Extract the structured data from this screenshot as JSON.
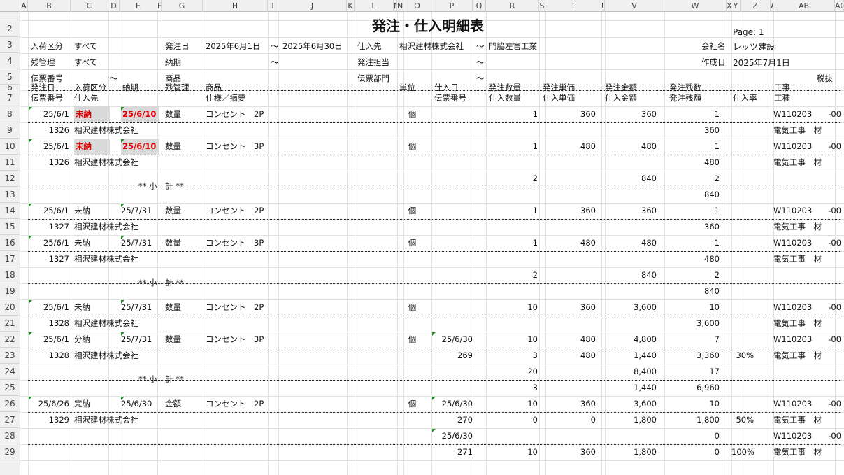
{
  "sheet": {
    "title": "発注・仕入明細表",
    "page": "Page: 1",
    "column_letters": [
      "A",
      "B",
      "C",
      "D",
      "E",
      "F",
      "G",
      "H",
      "I",
      "J",
      "K",
      "L",
      "M",
      "N",
      "O",
      "P",
      "Q",
      "R",
      "S",
      "T",
      "U",
      "V",
      "W",
      "X",
      "Y",
      "Z",
      "AA",
      "AB",
      "AC",
      "A"
    ],
    "row_numbers": [
      "1",
      "2",
      "3",
      "4",
      "5",
      "6",
      "7",
      "8",
      "9",
      "10",
      "11",
      "12",
      "13",
      "14",
      "15",
      "16",
      "17",
      "18",
      "19",
      "20",
      "21",
      "22",
      "23",
      "24",
      "25",
      "26",
      "27",
      "28",
      "29"
    ]
  },
  "filters": {
    "arrival_class_label": "入荷区分",
    "arrival_class_value": "すべて",
    "balance_mgmt_label": "残管理",
    "balance_mgmt_value": "すべて",
    "slip_no_label": "伝票番号",
    "slip_no_tilde": "～",
    "order_date_label": "発注日",
    "order_date_from": "2025年6月1日",
    "order_date_tilde": "～",
    "order_date_to": "2025年6月30日",
    "delivery_label": "納期",
    "delivery_tilde": "～",
    "product_label": "商品",
    "supplier_label": "仕入先",
    "supplier_from": "相沢建材株式会社",
    "supplier_tilde": "～",
    "supplier_to": "門脇左官工業",
    "staff_label": "発注担当",
    "staff_tilde": "～",
    "dept_label": "伝票部門",
    "dept_tilde": "～",
    "company_label": "会社名",
    "company_value": "レッツ建設",
    "created_label": "作成日",
    "created_value": "2025年7月1日",
    "tax_note": "税抜"
  },
  "headers": {
    "row6": [
      "発注日",
      "入荷区分",
      "納期",
      "残管理",
      "商品",
      "単位",
      "仕入日",
      "発注数量",
      "発注単価",
      "発注金額",
      "発注残数",
      "工事"
    ],
    "row7": [
      "伝票番号",
      "仕入先",
      "仕様／摘要",
      "伝票番号",
      "仕入数量",
      "仕入単価",
      "仕入金額",
      "発注残額",
      "仕入率",
      "工種"
    ]
  },
  "subtotal_label": "** 小　計 **",
  "rows": {
    "r8": {
      "date": "25/6/1",
      "cls": "未納",
      "due": "25/6/10",
      "mgmt": "数量",
      "item": "コンセント　2P",
      "unit": "個",
      "qty": "1",
      "price": "360",
      "amt": "360",
      "bal": "1",
      "koji": "W110203　　-00"
    },
    "r9": {
      "slip": "1326",
      "supplier": "相沢建材株式会社",
      "bal_amt": "360",
      "kind": "電気工事　材"
    },
    "r10": {
      "date": "25/6/1",
      "cls": "未納",
      "due": "25/6/10",
      "mgmt": "数量",
      "item": "コンセント　3P",
      "unit": "個",
      "qty": "1",
      "price": "480",
      "amt": "480",
      "bal": "1",
      "koji": "W110203　　-00"
    },
    "r11": {
      "slip": "1326",
      "supplier": "相沢建材株式会社",
      "bal_amt": "480",
      "kind": "電気工事　材"
    },
    "r12": {
      "qty": "2",
      "amt": "840",
      "bal": "2"
    },
    "r13": {
      "bal_amt": "840"
    },
    "r14": {
      "date": "25/6/1",
      "cls": "未納",
      "due": "25/7/31",
      "mgmt": "数量",
      "item": "コンセント　2P",
      "unit": "個",
      "qty": "1",
      "price": "360",
      "amt": "360",
      "bal": "1",
      "koji": "W110203　　-00"
    },
    "r15": {
      "slip": "1327",
      "supplier": "相沢建材株式会社",
      "bal_amt": "360",
      "kind": "電気工事　材"
    },
    "r16": {
      "date": "25/6/1",
      "cls": "未納",
      "due": "25/7/31",
      "mgmt": "数量",
      "item": "コンセント　3P",
      "unit": "個",
      "qty": "1",
      "price": "480",
      "amt": "480",
      "bal": "1",
      "koji": "W110203　　-00"
    },
    "r17": {
      "slip": "1327",
      "supplier": "相沢建材株式会社",
      "bal_amt": "480",
      "kind": "電気工事　材"
    },
    "r18": {
      "qty": "2",
      "amt": "840",
      "bal": "2"
    },
    "r19": {
      "bal_amt": "840"
    },
    "r20": {
      "date": "25/6/1",
      "cls": "未納",
      "due": "25/7/31",
      "mgmt": "数量",
      "item": "コンセント　2P",
      "unit": "個",
      "qty": "10",
      "price": "360",
      "amt": "3,600",
      "bal": "10",
      "koji": "W110203　　-00"
    },
    "r21": {
      "slip": "1328",
      "supplier": "相沢建材株式会社",
      "bal_amt": "3,600",
      "kind": "電気工事　材"
    },
    "r22": {
      "date": "25/6/1",
      "cls": "分納",
      "due": "25/7/31",
      "mgmt": "数量",
      "item": "コンセント　3P",
      "unit": "個",
      "pdate": "25/6/30",
      "qty": "10",
      "price": "480",
      "amt": "4,800",
      "bal": "7",
      "koji": "W110203　　-00"
    },
    "r23": {
      "slip": "1328",
      "supplier": "相沢建材株式会社",
      "pslip": "269",
      "pqty": "3",
      "pprice": "480",
      "pamt": "1,440",
      "bal_amt": "3,360",
      "rate": "30%",
      "kind": "電気工事　材"
    },
    "r24": {
      "qty": "20",
      "amt": "8,400",
      "bal": "17"
    },
    "r25": {
      "pqty": "3",
      "pamt": "1,440",
      "bal_amt": "6,960"
    },
    "r26": {
      "date": "25/6/26",
      "cls": "完納",
      "due": "25/6/30",
      "mgmt": "金額",
      "item": "コンセント　2P",
      "unit": "個",
      "pdate": "25/6/30",
      "qty": "10",
      "price": "360",
      "amt": "3,600",
      "bal": "10",
      "koji": "W110203　　-00"
    },
    "r27": {
      "slip": "1329",
      "supplier": "相沢建材株式会社",
      "pslip": "270",
      "pqty": "0",
      "pprice": "0",
      "pamt": "1,800",
      "bal_amt": "1,800",
      "rate": "50%",
      "kind": "電気工事　材"
    },
    "r28": {
      "pdate": "25/6/30",
      "bal": "0",
      "koji": "W110203　　-00"
    },
    "r29": {
      "pslip": "271",
      "pqty": "10",
      "pprice": "360",
      "pamt": "1,800",
      "bal_amt": "0",
      "rate": "100%",
      "kind": "電気工事　材"
    }
  }
}
